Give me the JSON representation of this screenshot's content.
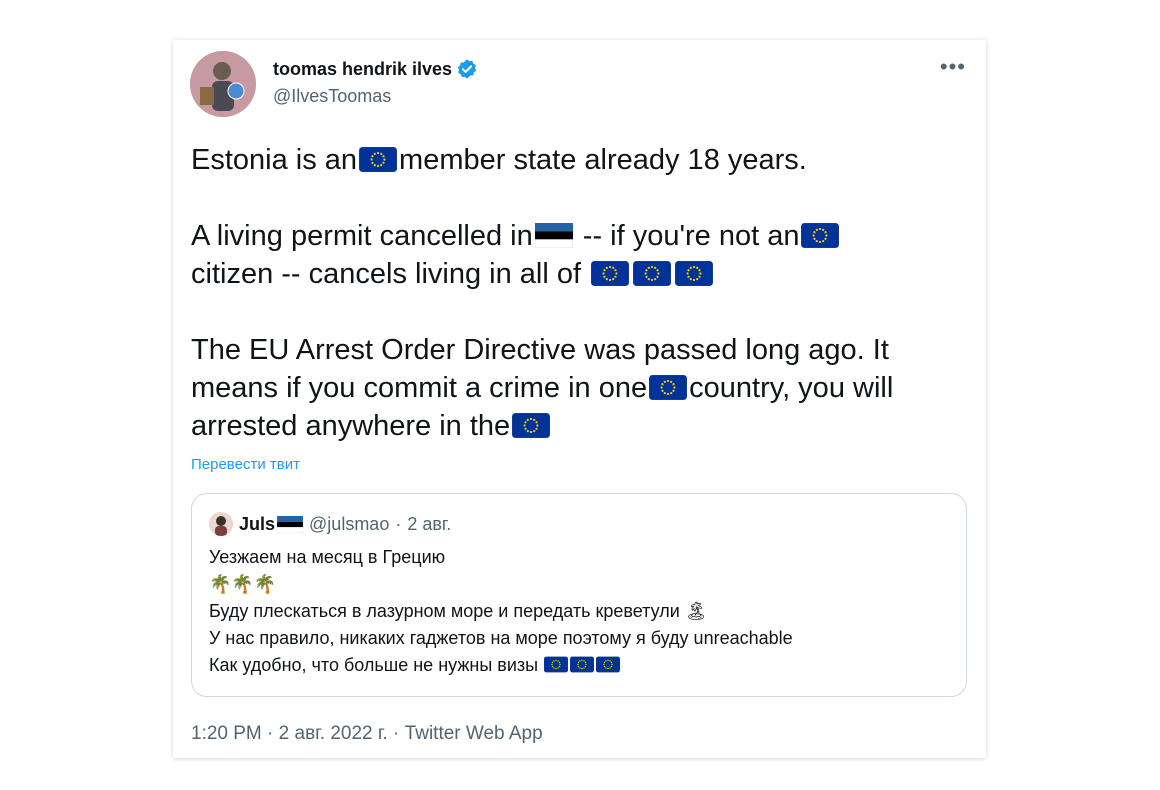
{
  "tweet": {
    "author_name": "toomas hendrik ilves",
    "author_handle": "@IlvesToomas",
    "more_glyph": "•••",
    "line1_before": "Estonia is an",
    "line1_after": "member state already 18 years.",
    "para2_a": "A living permit cancelled in",
    "para2_b": " -- if you're not an",
    "para2_c": "citizen -- cancels living in all of ",
    "para3_a": "The EU Arrest Order Directive was passed long ago. It means if you commit a crime in one",
    "para3_b": "country, you will arrested anywhere in the",
    "translate_label": "Перевести твит"
  },
  "quote": {
    "name": "Juls",
    "handle": "@julsmao",
    "date": "2 авг.",
    "line1": "Уезжаем на месяц в Грецию",
    "line2": "🌴🌴🌴",
    "line3": "Буду плескаться в лазурном море и передать креветули",
    "line3_emoji": "🏝",
    "line4": "У нас правило, никаких гаджетов на море поэтому я буду unreachable",
    "line5": "Как удобно, что больше не нужны визы "
  },
  "footer": {
    "time": "1:20 PM",
    "date": "2 авг. 2022 г.",
    "source": "Twitter Web App"
  },
  "icons": {
    "verified": "verified-badge-icon",
    "eu_flag": "eu-flag-icon",
    "estonia_flag": "estonia-flag-icon"
  },
  "colors": {
    "link": "#1d9bf0",
    "text": "#0f1419",
    "muted": "#536471",
    "eu_blue": "#003399",
    "eu_star": "#ffcc00"
  }
}
